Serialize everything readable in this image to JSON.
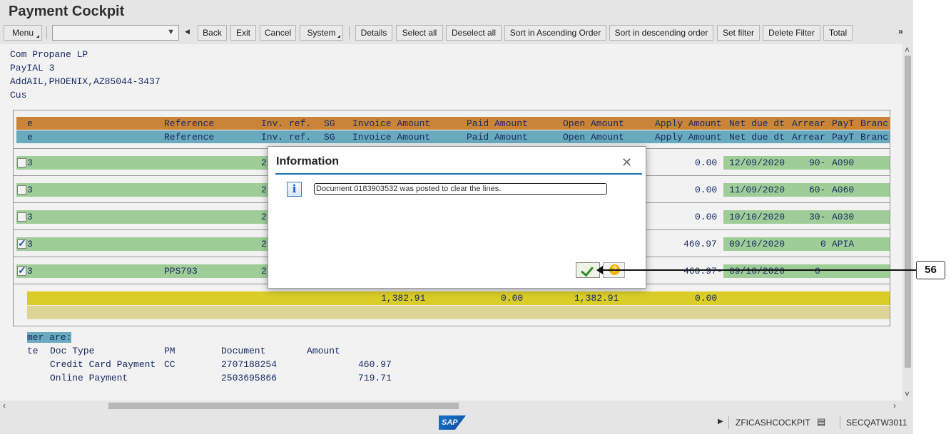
{
  "window": {
    "title": "Payment Cockpit"
  },
  "toolbar": {
    "menu_label": "Menu",
    "command_field_value": "",
    "back_label": "Back",
    "exit_label": "Exit",
    "cancel_label": "Cancel",
    "system_label": "System",
    "details_label": "Details",
    "select_all_label": "Select all",
    "deselect_all_label": "Deselect all",
    "sort_asc_label": "Sort in Ascending Order",
    "sort_desc_label": "Sort in descending order",
    "set_filter_label": "Set filter",
    "delete_filter_label": "Delete Filter",
    "total_label": "Total"
  },
  "customer": {
    "line1": "Com Propane LP",
    "line2": "PayIAL 3",
    "line3": "AddAIL,PHOENIX,AZ85044-3437",
    "line4": "Cus"
  },
  "grid": {
    "headers": [
      "e",
      "Reference",
      "Inv. ref.",
      "SG",
      "Invoice Amount",
      "Paid Amount",
      "Open Amount",
      "Apply Amount",
      "Net due dt",
      "Arrear",
      "PayT",
      "Branc"
    ],
    "rows": [
      {
        "checked": false,
        "c1": "3",
        "reference": "",
        "invref": "2",
        "apply": "0.00",
        "netdue": "12/09/2020",
        "arrear": "90-",
        "payt": "A090"
      },
      {
        "checked": false,
        "c1": "3",
        "reference": "",
        "invref": "2",
        "apply": "0.00",
        "netdue": "11/09/2020",
        "arrear": "60-",
        "payt": "A060"
      },
      {
        "checked": false,
        "c1": "3",
        "reference": "",
        "invref": "2",
        "apply": "0.00",
        "netdue": "10/10/2020",
        "arrear": "30-",
        "payt": "A030"
      },
      {
        "checked": true,
        "c1": "3",
        "reference": "",
        "invref": "2",
        "apply": "460.97",
        "netdue": "09/10/2020",
        "arrear": "0",
        "payt": "APIA"
      },
      {
        "checked": true,
        "c1": "3",
        "reference": "PPS793",
        "invref": "2",
        "apply": "460.97-",
        "netdue": "09/10/2020",
        "arrear": "0",
        "payt": ""
      }
    ],
    "totals": {
      "invoice": "1,382.91",
      "paid": "0.00",
      "open": "1,382.91",
      "apply": "0.00"
    }
  },
  "payments": {
    "heading": "mer are:",
    "col_te": "te",
    "col_doc_type": "Doc Type",
    "col_pm": "PM",
    "col_document": "Document",
    "col_amount": "Amount",
    "items": [
      {
        "doc_type": "Credit Card Payment",
        "pm": "CC",
        "document": "2707188254",
        "amount": "460.97"
      },
      {
        "doc_type": "Online Payment",
        "pm": "",
        "document": "2503695866",
        "amount": "719.71"
      }
    ]
  },
  "dialog": {
    "title": "Information",
    "message": "Document 0183903532 was posted to clear the lines."
  },
  "statusbar": {
    "logo": "SAP",
    "transaction": "ZFICASHCOCKPIT",
    "system": "SECQATW3011"
  },
  "callout": {
    "label": "56"
  },
  "colors": {
    "header_orange": "#d48c3c",
    "header_blue": "#6fb4c9",
    "row_green": "#a8d8a0",
    "total_yellow": "#e6d82a",
    "accent_blue": "#1a73b8"
  }
}
